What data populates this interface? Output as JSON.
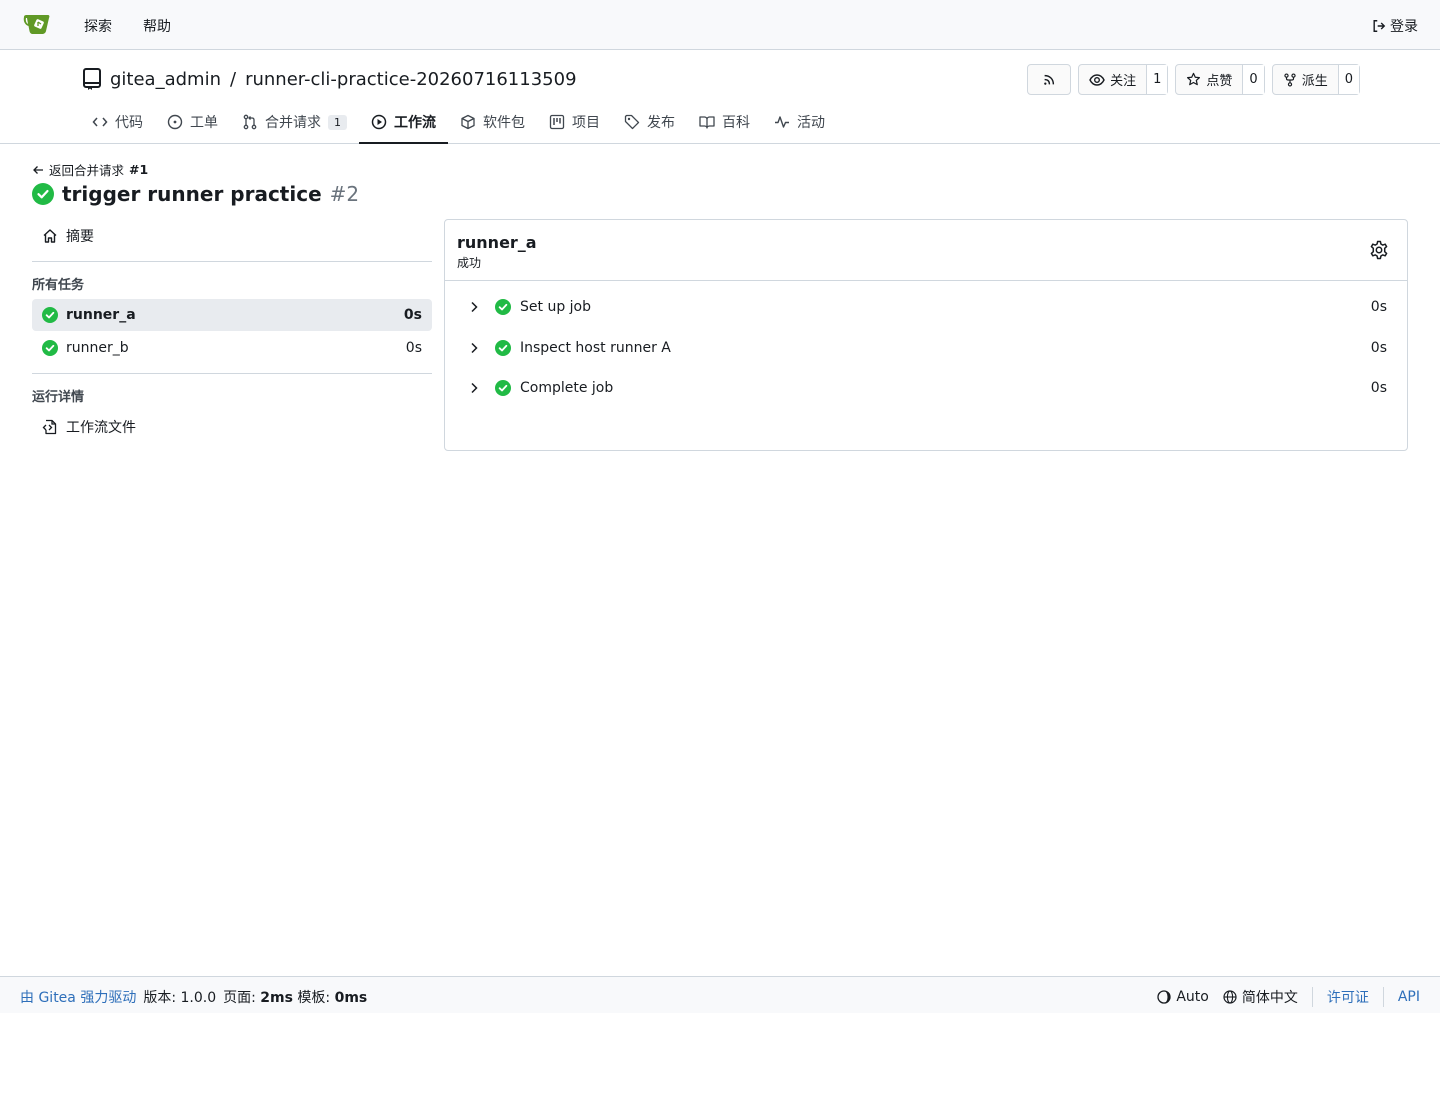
{
  "topnav": {
    "explore_label": "探索",
    "help_label": "帮助",
    "login_label": "登录"
  },
  "repo": {
    "owner": "gitea_admin",
    "separator": "/",
    "name": "runner-cli-practice-20260716113509",
    "watch_label": "关注",
    "watch_count": "1",
    "star_label": "点赞",
    "star_count": "0",
    "fork_label": "派生",
    "fork_count": "0"
  },
  "tabs": [
    {
      "label": "代码",
      "icon": "code-icon"
    },
    {
      "label": "工单",
      "icon": "issue-icon"
    },
    {
      "label": "合并请求",
      "icon": "pull-request-icon",
      "badge": "1"
    },
    {
      "label": "工作流",
      "icon": "play-icon",
      "active": true
    },
    {
      "label": "软件包",
      "icon": "package-icon"
    },
    {
      "label": "项目",
      "icon": "project-icon"
    },
    {
      "label": "发布",
      "icon": "tag-icon"
    },
    {
      "label": "百科",
      "icon": "book-icon"
    },
    {
      "label": "活动",
      "icon": "pulse-icon"
    }
  ],
  "run": {
    "back_label": "返回合并请求",
    "back_ref": "#1",
    "title": "trigger runner practice",
    "number": "#2",
    "status_color": "#21ba45"
  },
  "sidebar": {
    "summary_label": "摘要",
    "all_jobs_heading": "所有任务",
    "jobs": [
      {
        "name": "runner_a",
        "duration": "0s",
        "active": true
      },
      {
        "name": "runner_b",
        "duration": "0s",
        "active": false
      }
    ],
    "run_details_heading": "运行详情",
    "workflow_file_label": "工作流文件"
  },
  "job_panel": {
    "job_name": "runner_a",
    "status": "成功",
    "steps": [
      {
        "name": "Set up job",
        "duration": "0s"
      },
      {
        "name": "Inspect host runner A",
        "duration": "0s"
      },
      {
        "name": "Complete job",
        "duration": "0s"
      }
    ]
  },
  "footer": {
    "powered_by": "由 Gitea 强力驱动",
    "version_label": "版本: 1.0.0",
    "page_label": "页面:",
    "page_time": "2ms",
    "template_label": "模板:",
    "template_time": "0ms",
    "theme_label": "Auto",
    "language_label": "简体中文",
    "license_label": "许可证",
    "api_label": "API"
  }
}
